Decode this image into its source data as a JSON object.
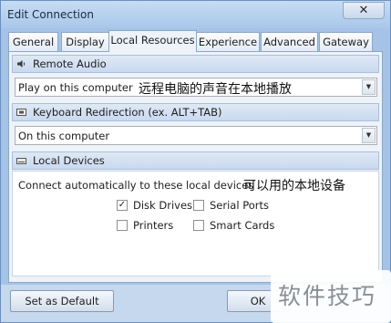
{
  "window": {
    "title": "Edit Connection",
    "close_glyph": "✕"
  },
  "tabs": [
    {
      "label": "General"
    },
    {
      "label": "Display"
    },
    {
      "label": "Local Resources",
      "active": true
    },
    {
      "label": "Experience"
    },
    {
      "label": "Advanced"
    },
    {
      "label": "Gateway"
    }
  ],
  "remote_audio": {
    "header": "Remote Audio",
    "icon": "speaker-icon",
    "selected": "Play on this computer",
    "annotation": "远程电脑的声音在本地播放"
  },
  "keyboard": {
    "header": "Keyboard Redirection (ex. ALT+TAB)",
    "icon": "keyboard-icon",
    "selected": "On this computer"
  },
  "local_devices": {
    "header": "Local Devices",
    "icon": "devices-icon",
    "connect_label": "Connect automatically to these local devices",
    "annotation": "可以用的本地设备",
    "options": [
      {
        "label": "Disk Drives",
        "checked": true
      },
      {
        "label": "Serial Ports",
        "checked": false
      },
      {
        "label": "Printers",
        "checked": false
      },
      {
        "label": "Smart Cards",
        "checked": false
      }
    ]
  },
  "footer": {
    "default_button": "Set as Default",
    "ok_button": "OK"
  },
  "watermark": "软件技巧",
  "glyphs": {
    "check": "✓",
    "dropdown": "▼"
  },
  "colors": {
    "chrome": "#a4c3e6",
    "panel": "#eef3fa",
    "header": "#c9d9ee"
  }
}
